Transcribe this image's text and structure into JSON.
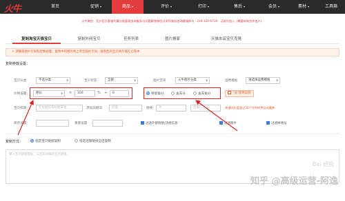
{
  "brand": {
    "logo_text": "火牛"
  },
  "nav": {
    "items": [
      {
        "label": "首页",
        "caret": ""
      },
      {
        "label": "促销",
        "caret": "▾"
      },
      {
        "label": "商品",
        "caret": "▾"
      },
      {
        "label": "评价",
        "caret": "▾"
      },
      {
        "label": "打印",
        "caret": "▾"
      },
      {
        "label": "售后",
        "caret": "▾"
      },
      {
        "label": "会员",
        "caret": "▾"
      },
      {
        "label": "素材",
        "caret": "▾"
      },
      {
        "label": "工具箱",
        "caret": ""
      }
    ],
    "active_index": 2
  },
  "notice": {
    "text": "火牛微信：官方官方客服专属分类管理咨询服务与问题解答微信订阅号服务咨询客服群与 · 244-321-6719 · 订阅号加入（需要有效合作加入）"
  },
  "tabs": {
    "items": [
      "复制淘宝天猫宝贝",
      "复制外网宝贝",
      "任务列表",
      "图片搬家",
      "天猫本店宝贝克隆"
    ],
    "active_index": 0
  },
  "warning": {
    "text": "⚠ 请确保图片空间有足够容量，复制中的图片将上传至图片空间，复制后的宝贝将存储在仓库中"
  },
  "settings": {
    "title": "复制参数设置：",
    "row1": {
      "category_label": "宝贝分类",
      "category_value": "不选分类",
      "sale_label": "宝贝状态",
      "sale_value": "全部",
      "image_label": "图片空间",
      "image_value": "火牛图片分类",
      "shop_label": "运费模板",
      "shop_value": "请选择运费模板"
    },
    "row2": {
      "price_label": "价格设置：",
      "price_base": "原价",
      "multiply": "×",
      "percent_value": "100",
      "percent_sign": "%",
      "plus": "+",
      "add_value": "0",
      "round_options": [
        "保留角分",
        "舍去分",
        "舍去角分"
      ],
      "round_selected": 0,
      "badge": "“减”使用说明"
    },
    "row3": {
      "title_label": "宝贝标题：",
      "title_placeholder": "在标题前或标题末加...",
      "pre_label": "添加前缀词",
      "pre_placeholder": "前缀",
      "replace_label": "替换",
      "replace_placeholder": "为",
      "post_placeholder": "后缀",
      "hint": "关键词长度超过30个字符时将自动截断"
    },
    "row4": {
      "stock_label": "库存设置：",
      "stock_value": "",
      "weight_label": "重量设置",
      "weight_value": "",
      "checks": [
        "过滤外部链接/违规信息",
        "过滤图片",
        "过滤掉地址"
      ],
      "checks_on": [
        true,
        true,
        true
      ]
    }
  },
  "copy_mode": {
    "title": "复制方式：",
    "options": [
      "指定宝贝链接复制",
      "指定店铺链接全店复制"
    ],
    "selected": 0,
    "textarea_placeholder": "输入宝贝链接地址，以回车分隔的宝贝链接..."
  },
  "watermark": {
    "zhihu": "知乎 @高级运营-阿逸",
    "baidu": "Bai 经验"
  },
  "colors": {
    "accent": "#e43c3c",
    "topbar": "#2a2a2a",
    "annotation": "#e02020",
    "selected": "#3a7be0"
  }
}
